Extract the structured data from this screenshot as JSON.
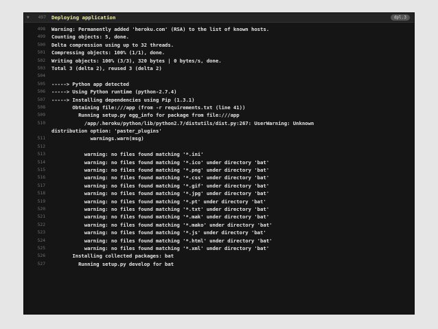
{
  "header": {
    "line_number": "497",
    "title": "Deploying application",
    "badge": "dpl.3"
  },
  "log_lines": [
    {
      "num": "498",
      "text": "Warning: Permanently added 'heroku.com' (RSA) to the list of known hosts."
    },
    {
      "num": "499",
      "text": "Counting objects: 5, done."
    },
    {
      "num": "500",
      "text": "Delta compression using up to 32 threads."
    },
    {
      "num": "501",
      "text": "Compressing objects: 100% (1/1), done."
    },
    {
      "num": "502",
      "text": "Writing objects: 100% (3/3), 320 bytes | 0 bytes/s, done."
    },
    {
      "num": "503",
      "text": "Total 3 (delta 2), reused 3 (delta 2)"
    },
    {
      "num": "504",
      "text": ""
    },
    {
      "num": "505",
      "text": "-----> Python app detected"
    },
    {
      "num": "506",
      "text": "-----> Using Python runtime (python-2.7.4)"
    },
    {
      "num": "507",
      "text": "-----> Installing dependencies using Pip (1.3.1)"
    },
    {
      "num": "508",
      "text": "       Obtaining file:///app (from -r requirements.txt (line 41))"
    },
    {
      "num": "509",
      "text": "         Running setup.py egg_info for package from file:///app"
    },
    {
      "num": "510",
      "text": "           /app/.heroku/python/lib/python2.7/distutils/dist.py:267: UserWarning: Unknown"
    },
    {
      "num": "",
      "text": "distribution option: 'paster_plugins'"
    },
    {
      "num": "511",
      "text": "             warnings.warn(msg)"
    },
    {
      "num": "512",
      "text": ""
    },
    {
      "num": "513",
      "text": "           warning: no files found matching '*.ini'"
    },
    {
      "num": "514",
      "text": "           warning: no files found matching '*.ico' under directory 'bat'"
    },
    {
      "num": "515",
      "text": "           warning: no files found matching '*.png' under directory 'bat'"
    },
    {
      "num": "516",
      "text": "           warning: no files found matching '*.css' under directory 'bat'"
    },
    {
      "num": "517",
      "text": "           warning: no files found matching '*.gif' under directory 'bat'"
    },
    {
      "num": "518",
      "text": "           warning: no files found matching '*.jpg' under directory 'bat'"
    },
    {
      "num": "519",
      "text": "           warning: no files found matching '*.pt' under directory 'bat'"
    },
    {
      "num": "520",
      "text": "           warning: no files found matching '*.txt' under directory 'bat'"
    },
    {
      "num": "521",
      "text": "           warning: no files found matching '*.mak' under directory 'bat'"
    },
    {
      "num": "522",
      "text": "           warning: no files found matching '*.mako' under directory 'bat'"
    },
    {
      "num": "523",
      "text": "           warning: no files found matching '*.js' under directory 'bat'"
    },
    {
      "num": "524",
      "text": "           warning: no files found matching '*.html' under directory 'bat'"
    },
    {
      "num": "525",
      "text": "           warning: no files found matching '*.xml' under directory 'bat'"
    },
    {
      "num": "526",
      "text": "       Installing collected packages: bat"
    },
    {
      "num": "527",
      "text": "         Running setup.py develop for bat"
    }
  ]
}
